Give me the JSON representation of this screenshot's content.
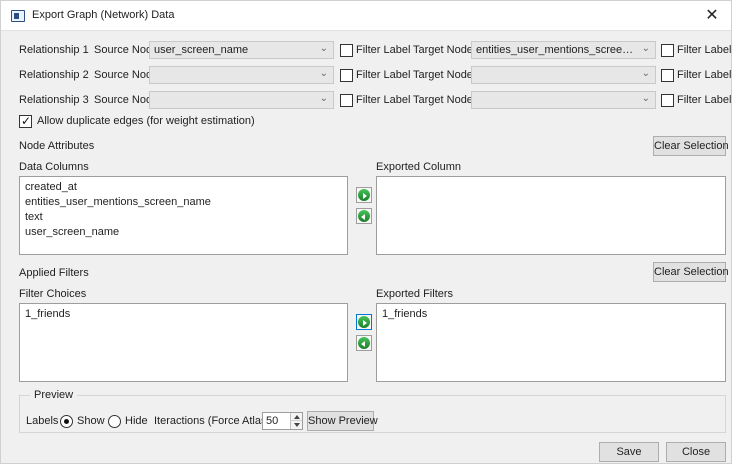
{
  "window": {
    "title": "Export Graph (Network) Data",
    "close_glyph": "✕"
  },
  "relationships": [
    {
      "label": "Relationship 1",
      "source_label": "Source Node",
      "source_value": "user_screen_name",
      "filter_label": "Filter Label",
      "target_label": "Target Node",
      "target_value": "entities_user_mentions_screen_name",
      "target_filter_label": "Filter Label"
    },
    {
      "label": "Relationship 2",
      "source_label": "Source Node",
      "source_value": "",
      "filter_label": "Filter Label",
      "target_label": "Target Node",
      "target_value": "",
      "target_filter_label": "Filter Label"
    },
    {
      "label": "Relationship 3",
      "source_label": "Source Node",
      "source_value": "",
      "filter_label": "Filter Label",
      "target_label": "Target Node",
      "target_value": "",
      "target_filter_label": "Filter Label"
    }
  ],
  "allow_duplicates": {
    "label": "Allow duplicate edges (for weight estimation)",
    "checked": true
  },
  "node_attributes": {
    "section_label": "Node Attributes",
    "clear_label": "Clear Selection",
    "data_columns_label": "Data Columns",
    "exported_column_label": "Exported Column",
    "data_columns": [
      "created_at",
      "entities_user_mentions_screen_name",
      "text",
      "user_screen_name"
    ],
    "exported_columns": []
  },
  "applied_filters": {
    "section_label": "Applied Filters",
    "clear_label": "Clear Selection",
    "filter_choices_label": "Filter Choices",
    "exported_filters_label": "Exported Filters",
    "filter_choices": [
      "1_friends"
    ],
    "exported_filters": [
      "1_friends"
    ]
  },
  "preview": {
    "legend": "Preview",
    "labels_label": "Labels",
    "show_label": "Show",
    "hide_label": "Hide",
    "iterations_label": "Iteractions (Force Atlas)",
    "iterations_value": "50",
    "show_preview_button": "Show Preview"
  },
  "footer": {
    "save_label": "Save",
    "close_label": "Close"
  },
  "icons": {
    "dropdown": "chevron-down-icon",
    "move_right": "arrow-right-circle-icon",
    "move_left": "arrow-left-circle-icon",
    "close": "close-icon"
  }
}
